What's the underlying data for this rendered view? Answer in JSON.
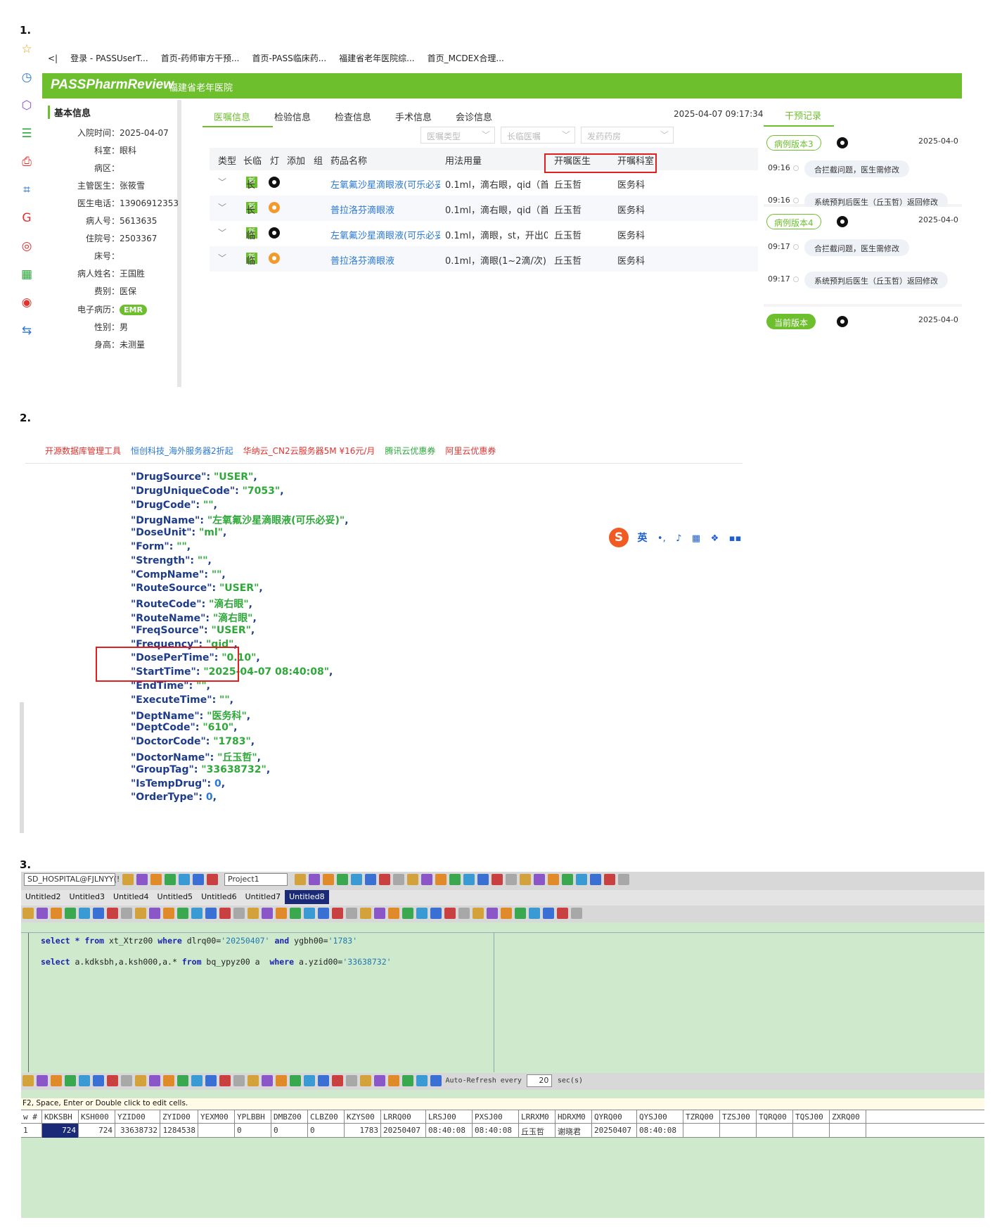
{
  "labels": {
    "s1": "1.",
    "s2": "2.",
    "s3": "3."
  },
  "section1": {
    "bookmarks": [
      "<|",
      "登录 - PASSUserT...",
      "首页-药师审方干预...",
      "首页-PASS临床药...",
      "福建省老年医院综...",
      "首页_MCDEX合理..."
    ],
    "sidebar_icons": [
      "star-icon",
      "history-icon",
      "puzzle-icon",
      "document-icon",
      "pdf-icon",
      "crop-icon",
      "gif-icon",
      "record-icon",
      "qrcode-icon",
      "weibo-icon",
      "translate-icon"
    ],
    "brand": {
      "logo": "PASSPharmReview",
      "hospital": "福建省老年医院"
    },
    "info_title": "基本信息",
    "info": [
      {
        "k": "入院时间：",
        "v": "2025-04-07"
      },
      {
        "k": "科室：",
        "v": "眼科"
      },
      {
        "k": "病区：",
        "v": ""
      },
      {
        "k": "主管医生：",
        "v": "张筱雪"
      },
      {
        "k": "医生电话：",
        "v": "13906912353"
      },
      {
        "k": "病人号：",
        "v": "5613635"
      },
      {
        "k": "住院号：",
        "v": "2503367"
      },
      {
        "k": "床号：",
        "v": ""
      },
      {
        "k": "病人姓名：",
        "v": "王国胜"
      },
      {
        "k": "费别：",
        "v": "医保"
      },
      {
        "k": "电子病历：",
        "v": "EMR"
      },
      {
        "k": "性别：",
        "v": "男"
      },
      {
        "k": "身高：",
        "v": "未测量"
      }
    ],
    "tabs": [
      "医嘱信息",
      "检验信息",
      "检查信息",
      "手术信息",
      "会诊信息"
    ],
    "datetime": "2025-04-07 09:17:34",
    "filters": [
      "医嘱类型",
      "长临医嘱",
      "发药药房"
    ],
    "columns": [
      "类型",
      "长临",
      "灯",
      "添加",
      "组",
      "药品名称",
      "用法用量",
      "开嘱医生",
      "开嘱科室"
    ],
    "rows": [
      {
        "type": "新",
        "term": "长",
        "light": "black",
        "drug": "左氧氟沙星滴眼液(可乐必妥",
        "usage": "0.1ml，滴右眼，qid（首...",
        "doctor": "丘玉哲",
        "dept": "医务科"
      },
      {
        "type": "新",
        "term": "长",
        "light": "orange",
        "drug": "普拉洛芬滴眼液",
        "usage": "0.1ml，滴右眼，qid（首...",
        "doctor": "丘玉哲",
        "dept": "医务科"
      },
      {
        "type": "新",
        "term": "临",
        "light": "black",
        "drug": "左氧氟沙星滴眼液(可乐必妥",
        "usage": "0.1ml，滴眼，st，开出0...",
        "doctor": "丘玉哲",
        "dept": "医务科"
      },
      {
        "type": "新",
        "term": "临",
        "light": "orange",
        "drug": "普拉洛芬滴眼液",
        "usage": "0.1ml，滴眼(1~2滴/次)，...",
        "doctor": "丘玉哲",
        "dept": "医务科"
      }
    ],
    "right_title": "干预记录",
    "versions": [
      {
        "label": "病例版本3",
        "date": "2025-04-0",
        "events": [
          {
            "time": "09:16",
            "msg": "合拦截问题，医生需修改"
          },
          {
            "time": "09:16",
            "msg": "系统预判后医生（丘玉哲）返回修改"
          }
        ]
      },
      {
        "label": "病例版本4",
        "date": "2025-04-0",
        "events": [
          {
            "time": "09:17",
            "msg": "合拦截问题，医生需修改"
          },
          {
            "time": "09:17",
            "msg": "系统预判后医生（丘玉哲）返回修改"
          }
        ]
      },
      {
        "label": "当前版本",
        "date": "2025-04-0",
        "events": []
      }
    ]
  },
  "section2": {
    "ads": [
      {
        "text": "开源数据库管理工具",
        "color": "red"
      },
      {
        "text": "恒创科技_海外服务器2折起",
        "color": "blue"
      },
      {
        "text": "华纳云_CN2云服务器5M ¥16元/月",
        "color": "red"
      },
      {
        "text": "腾讯云优惠券",
        "color": "green"
      },
      {
        "text": "阿里云优惠券",
        "color": "red"
      }
    ],
    "ime": {
      "logo": "S",
      "lang": "英"
    },
    "json_lines": [
      {
        "k": "\"DrugSource\"",
        "v": "\"USER\"",
        "t": "s"
      },
      {
        "k": "\"DrugUniqueCode\"",
        "v": "\"7053\"",
        "t": "s"
      },
      {
        "k": "\"DrugCode\"",
        "v": "\"\"",
        "t": "s"
      },
      {
        "k": "\"DrugName\"",
        "v": "\"左氧氟沙星滴眼液(可乐必妥)\"",
        "t": "s"
      },
      {
        "k": "\"DoseUnit\"",
        "v": "\"ml\"",
        "t": "s"
      },
      {
        "k": "\"Form\"",
        "v": "\"\"",
        "t": "s"
      },
      {
        "k": "\"Strength\"",
        "v": "\"\"",
        "t": "s"
      },
      {
        "k": "\"CompName\"",
        "v": "\"\"",
        "t": "s"
      },
      {
        "k": "\"RouteSource\"",
        "v": "\"USER\"",
        "t": "s"
      },
      {
        "k": "\"RouteCode\"",
        "v": "\"滴右眼\"",
        "t": "s"
      },
      {
        "k": "\"RouteName\"",
        "v": "\"滴右眼\"",
        "t": "s"
      },
      {
        "k": "\"FreqSource\"",
        "v": "\"USER\"",
        "t": "s"
      },
      {
        "k": "\"Frequency\"",
        "v": "\"qid\"",
        "t": "s"
      },
      {
        "k": "\"DosePerTime\"",
        "v": "\"0.10\"",
        "t": "s"
      },
      {
        "k": "\"StartTime\"",
        "v": "\"2025-04-07 08:40:08\"",
        "t": "s"
      },
      {
        "k": "\"EndTime\"",
        "v": "\"\"",
        "t": "s"
      },
      {
        "k": "\"ExecuteTime\"",
        "v": "\"\"",
        "t": "s"
      },
      {
        "k": "\"DeptName\"",
        "v": "\"医务科\"",
        "t": "s"
      },
      {
        "k": "\"DeptCode\"",
        "v": "\"610\"",
        "t": "s"
      },
      {
        "k": "\"DoctorCode\"",
        "v": "\"1783\"",
        "t": "s"
      },
      {
        "k": "\"DoctorName\"",
        "v": "\"丘玉哲\"",
        "t": "s"
      },
      {
        "k": "\"GroupTag\"",
        "v": "\"33638732\"",
        "t": "s"
      },
      {
        "k": "\"IsTempDrug\"",
        "v": "0",
        "t": "n"
      },
      {
        "k": "\"OrderType\"",
        "v": "0",
        "t": "n"
      }
    ]
  },
  "section3": {
    "connection": "SD_HOSPITAL@FJLNYY(!",
    "project": "Project1",
    "doc_tabs": [
      "Untitled2",
      "Untitled3",
      "Untitled4",
      "Untitled5",
      "Untitled6",
      "Untitled7",
      "Untitled8"
    ],
    "active_tab": "Untitled8",
    "sql": [
      [
        {
          "t": "select",
          "c": "kw"
        },
        {
          "t": " ",
          "c": ""
        },
        {
          "t": "*",
          "c": "kw"
        },
        {
          "t": " ",
          "c": ""
        },
        {
          "t": "from",
          "c": "kw"
        },
        {
          "t": " xt_Xtrz00 ",
          "c": ""
        },
        {
          "t": "where",
          "c": "kw"
        },
        {
          "t": " dlrq00=",
          "c": ""
        },
        {
          "t": "'20250407'",
          "c": "str"
        },
        {
          "t": " ",
          "c": ""
        },
        {
          "t": "and",
          "c": "kw"
        },
        {
          "t": " ygbh00=",
          "c": ""
        },
        {
          "t": "'1783'",
          "c": "str"
        }
      ],
      [
        {
          "t": "select",
          "c": "kw"
        },
        {
          "t": " a.kdksbh,a.ksh000,a.* ",
          "c": ""
        },
        {
          "t": "from",
          "c": "kw"
        },
        {
          "t": " bq_ypyz00 a  ",
          "c": ""
        },
        {
          "t": "where",
          "c": "kw"
        },
        {
          "t": " a.yzid00=",
          "c": ""
        },
        {
          "t": "'33638732'",
          "c": "str"
        }
      ]
    ],
    "auto_refresh": {
      "label": "Auto-Refresh every",
      "value": "20",
      "unit": "sec(s)"
    },
    "hint": "F2, Space, Enter or Double click to edit cells.",
    "grid_cols": [
      "w #",
      "KDKSBH",
      "KSH000",
      "YZID00",
      "ZYID00",
      "YEXM00",
      "YPLBBH",
      "DMBZ00",
      "CLBZ00",
      "KZYS00",
      "LRRQ00",
      "LRSJ00",
      "PXSJ00",
      "LRRXM0",
      "HDRXM0",
      "QYRQ00",
      "QYSJ00",
      "TZRQ00",
      "TZSJ00",
      "TQRQ00",
      "TQSJ00",
      "ZXRQ00"
    ],
    "grid_row": [
      "1",
      "724",
      "724",
      "33638732",
      "1284538",
      "",
      "0",
      "0",
      "0",
      "1783",
      "20250407",
      "08:40:08",
      "08:40:08",
      "丘玉哲",
      "谢晓君",
      "20250407",
      "08:40:08",
      "",
      "",
      "",
      "",
      ""
    ]
  }
}
